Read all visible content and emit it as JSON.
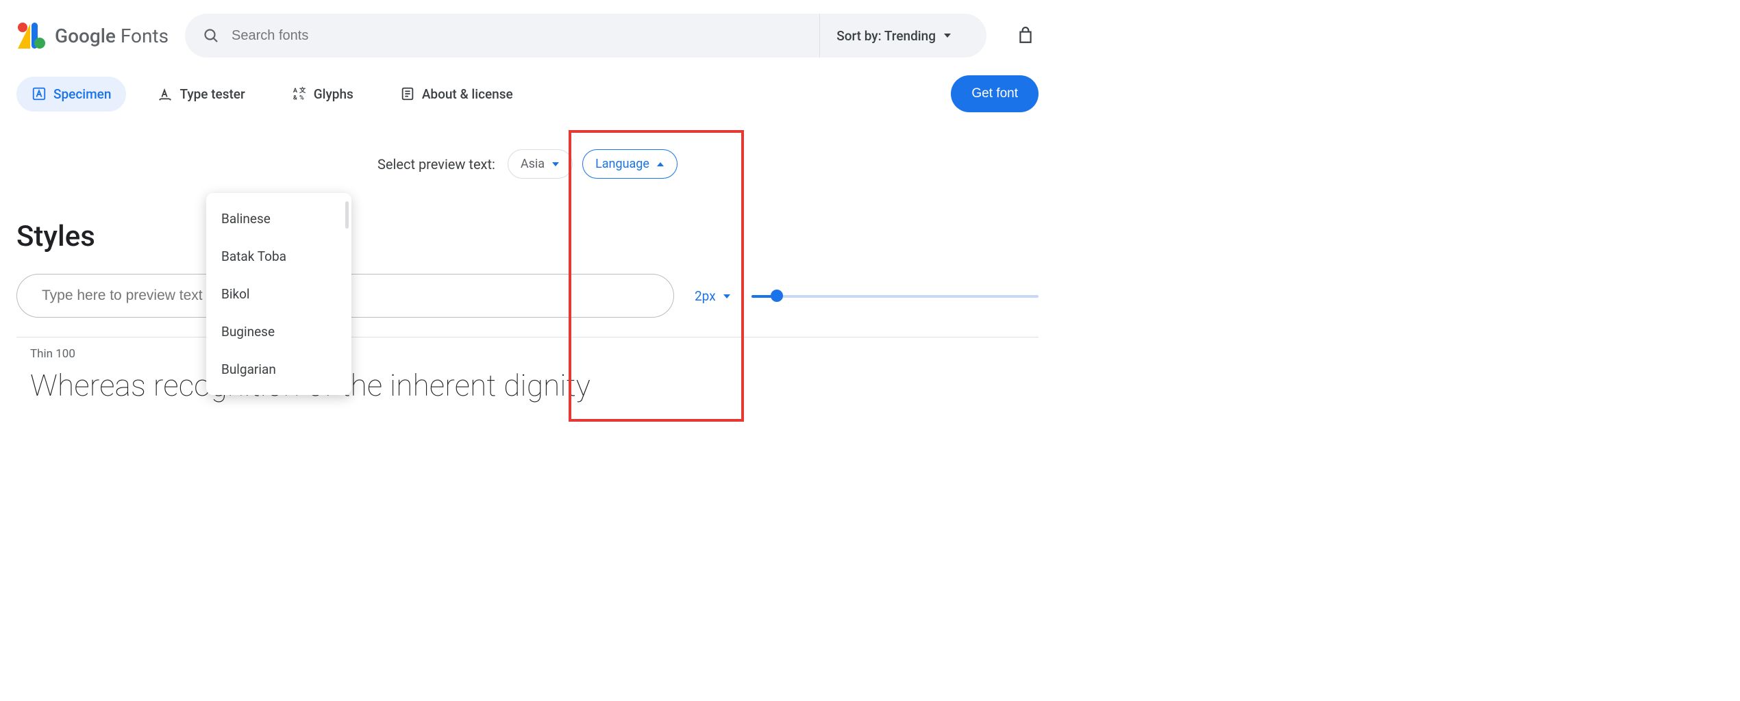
{
  "header": {
    "brand_google": "Google",
    "brand_fonts": "Fonts",
    "search_placeholder": "Search fonts",
    "sort_label": "Sort by: Trending"
  },
  "tabs": {
    "specimen": "Specimen",
    "type_tester": "Type tester",
    "glyphs": "Glyphs",
    "about": "About & license",
    "get_font": "Get font"
  },
  "preview_sel": {
    "label": "Select preview text:",
    "region": "Asia",
    "language": "Language"
  },
  "dropdown": {
    "items": [
      "Balinese",
      "Batak Toba",
      "Bikol",
      "Buginese",
      "Bulgarian"
    ]
  },
  "styles": {
    "heading": "Styles",
    "preview_placeholder": "Type here to preview text",
    "size_value": "2px",
    "weight_label": "Thin 100",
    "preview_text": "Whereas recognition of the inherent dignity"
  }
}
